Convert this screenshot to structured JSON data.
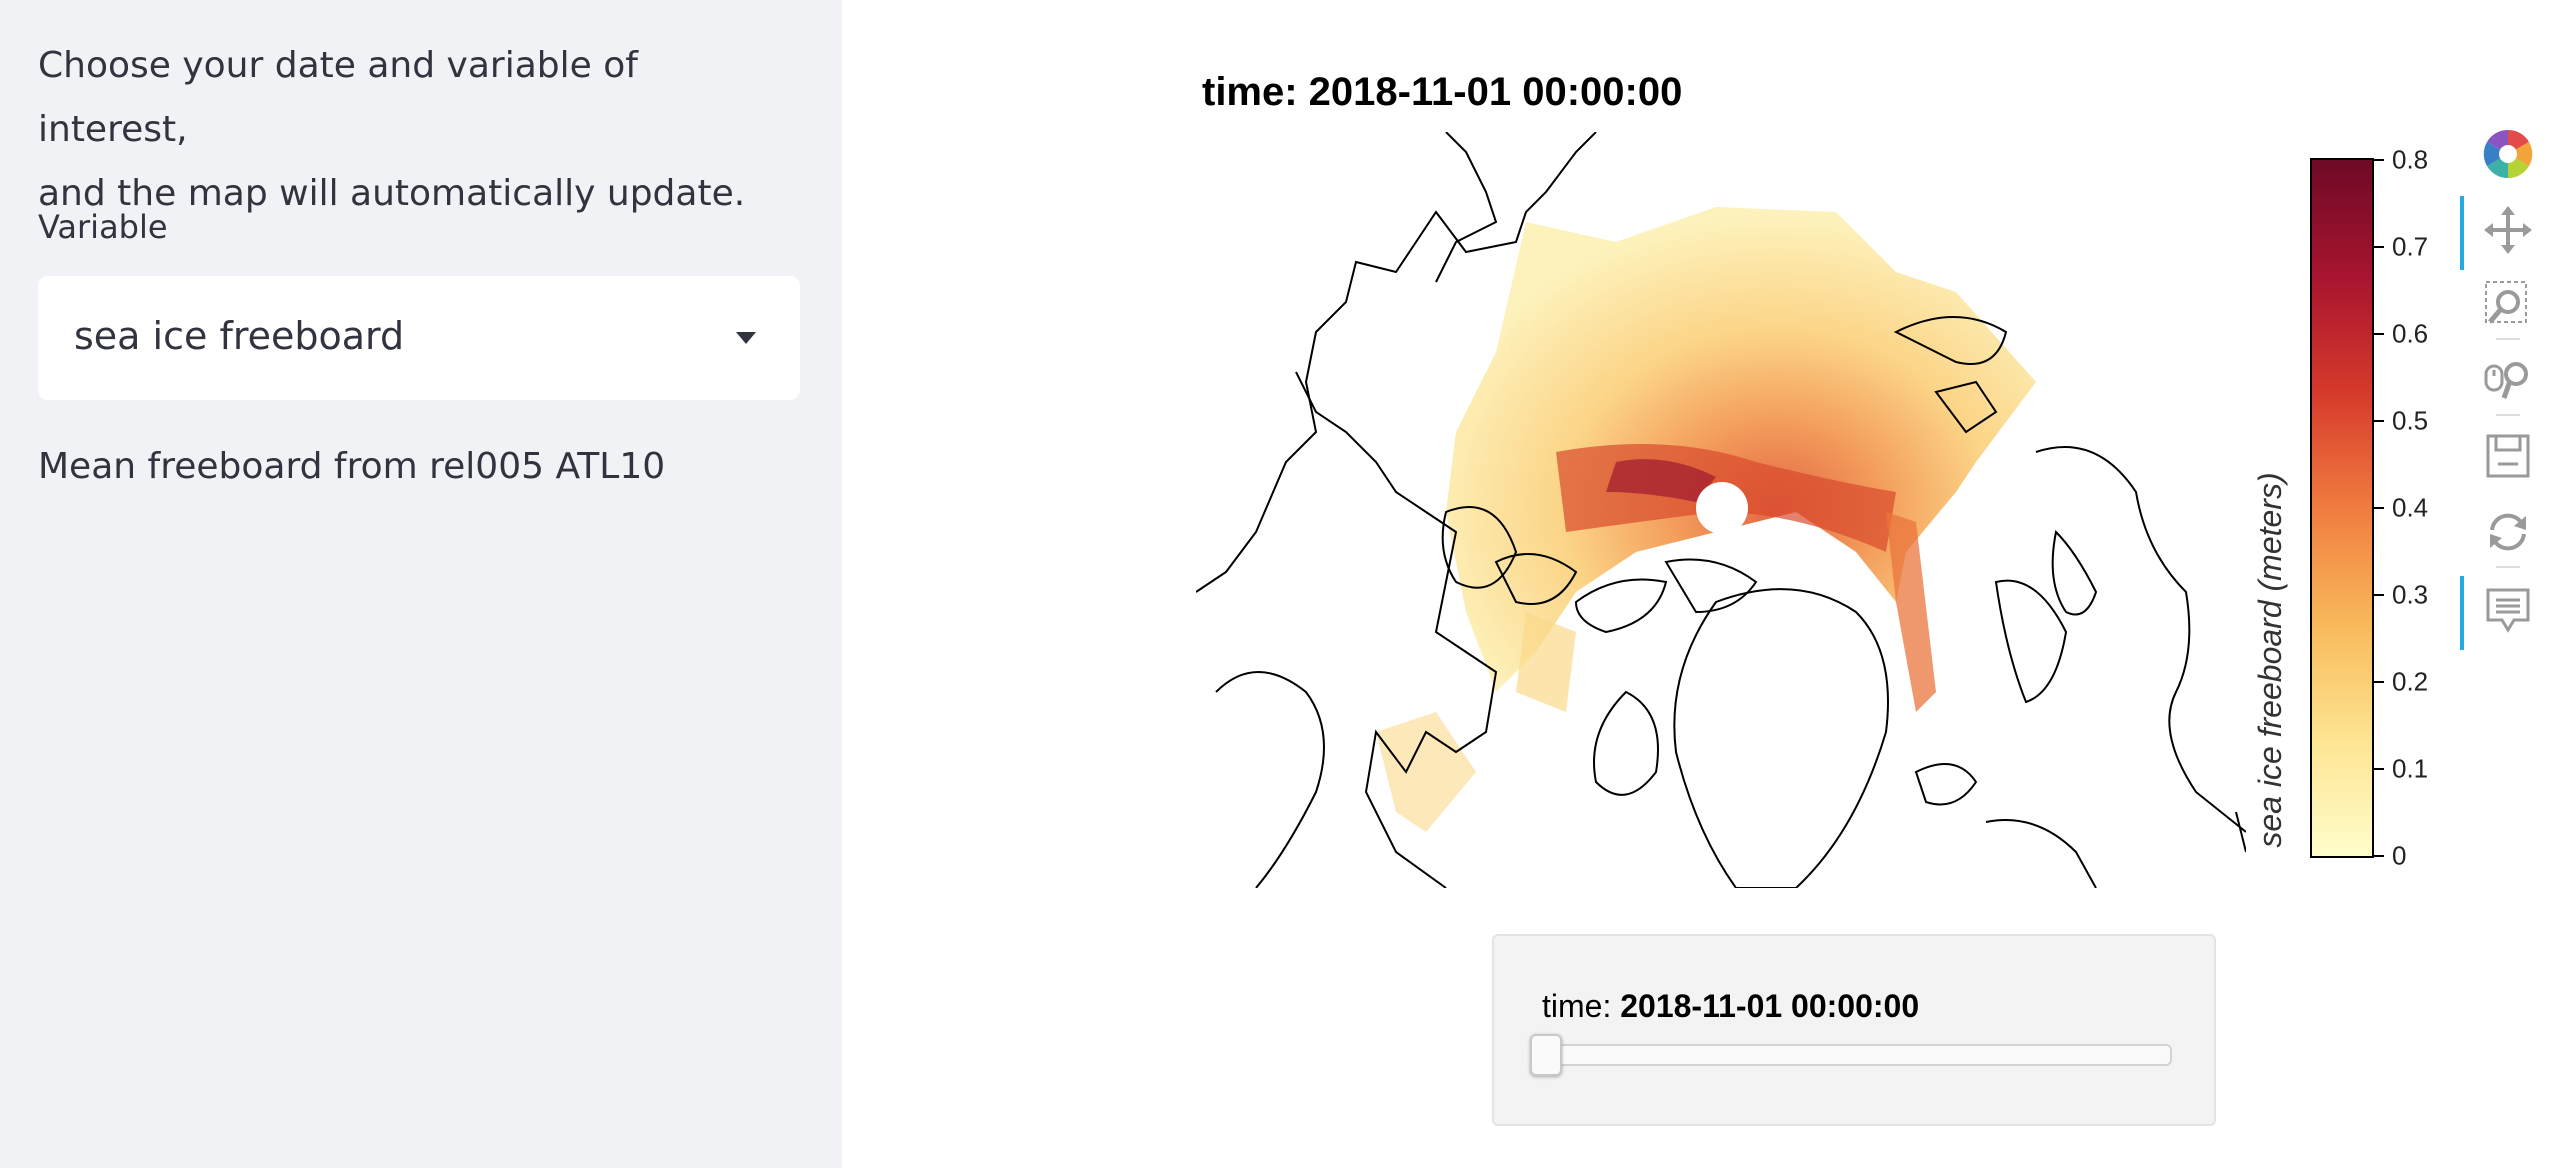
{
  "sidebar": {
    "intro_line1": "Choose your date and variable of interest,",
    "intro_line2": "and the map will automatically update.",
    "variable_label": "Variable",
    "variable_selected": "sea ice freeboard",
    "description": "Mean freeboard from rel005 ATL10"
  },
  "plot": {
    "title": "time: 2018-11-01 00:00:00",
    "colorbar": {
      "title": "sea ice freeboard (meters)",
      "min": 0,
      "max": 0.8,
      "ticks": [
        "0",
        "0.1",
        "0.2",
        "0.3",
        "0.4",
        "0.5",
        "0.6",
        "0.7",
        "0.8"
      ],
      "colormap": [
        "#fffdcc",
        "#fde592",
        "#f9b95a",
        "#f07c3f",
        "#d6392b",
        "#a7142f",
        "#6e0a26"
      ]
    }
  },
  "toolbar": {
    "tools": [
      "bokeh-logo-icon",
      "pan-icon",
      "box-zoom-icon",
      "wheel-zoom-icon",
      "save-icon",
      "reset-icon",
      "hover-icon"
    ],
    "active_color": "#26aae1"
  },
  "slider": {
    "label_prefix": "time:",
    "label_value": "2018-11-01 00:00:00",
    "position": 0
  }
}
